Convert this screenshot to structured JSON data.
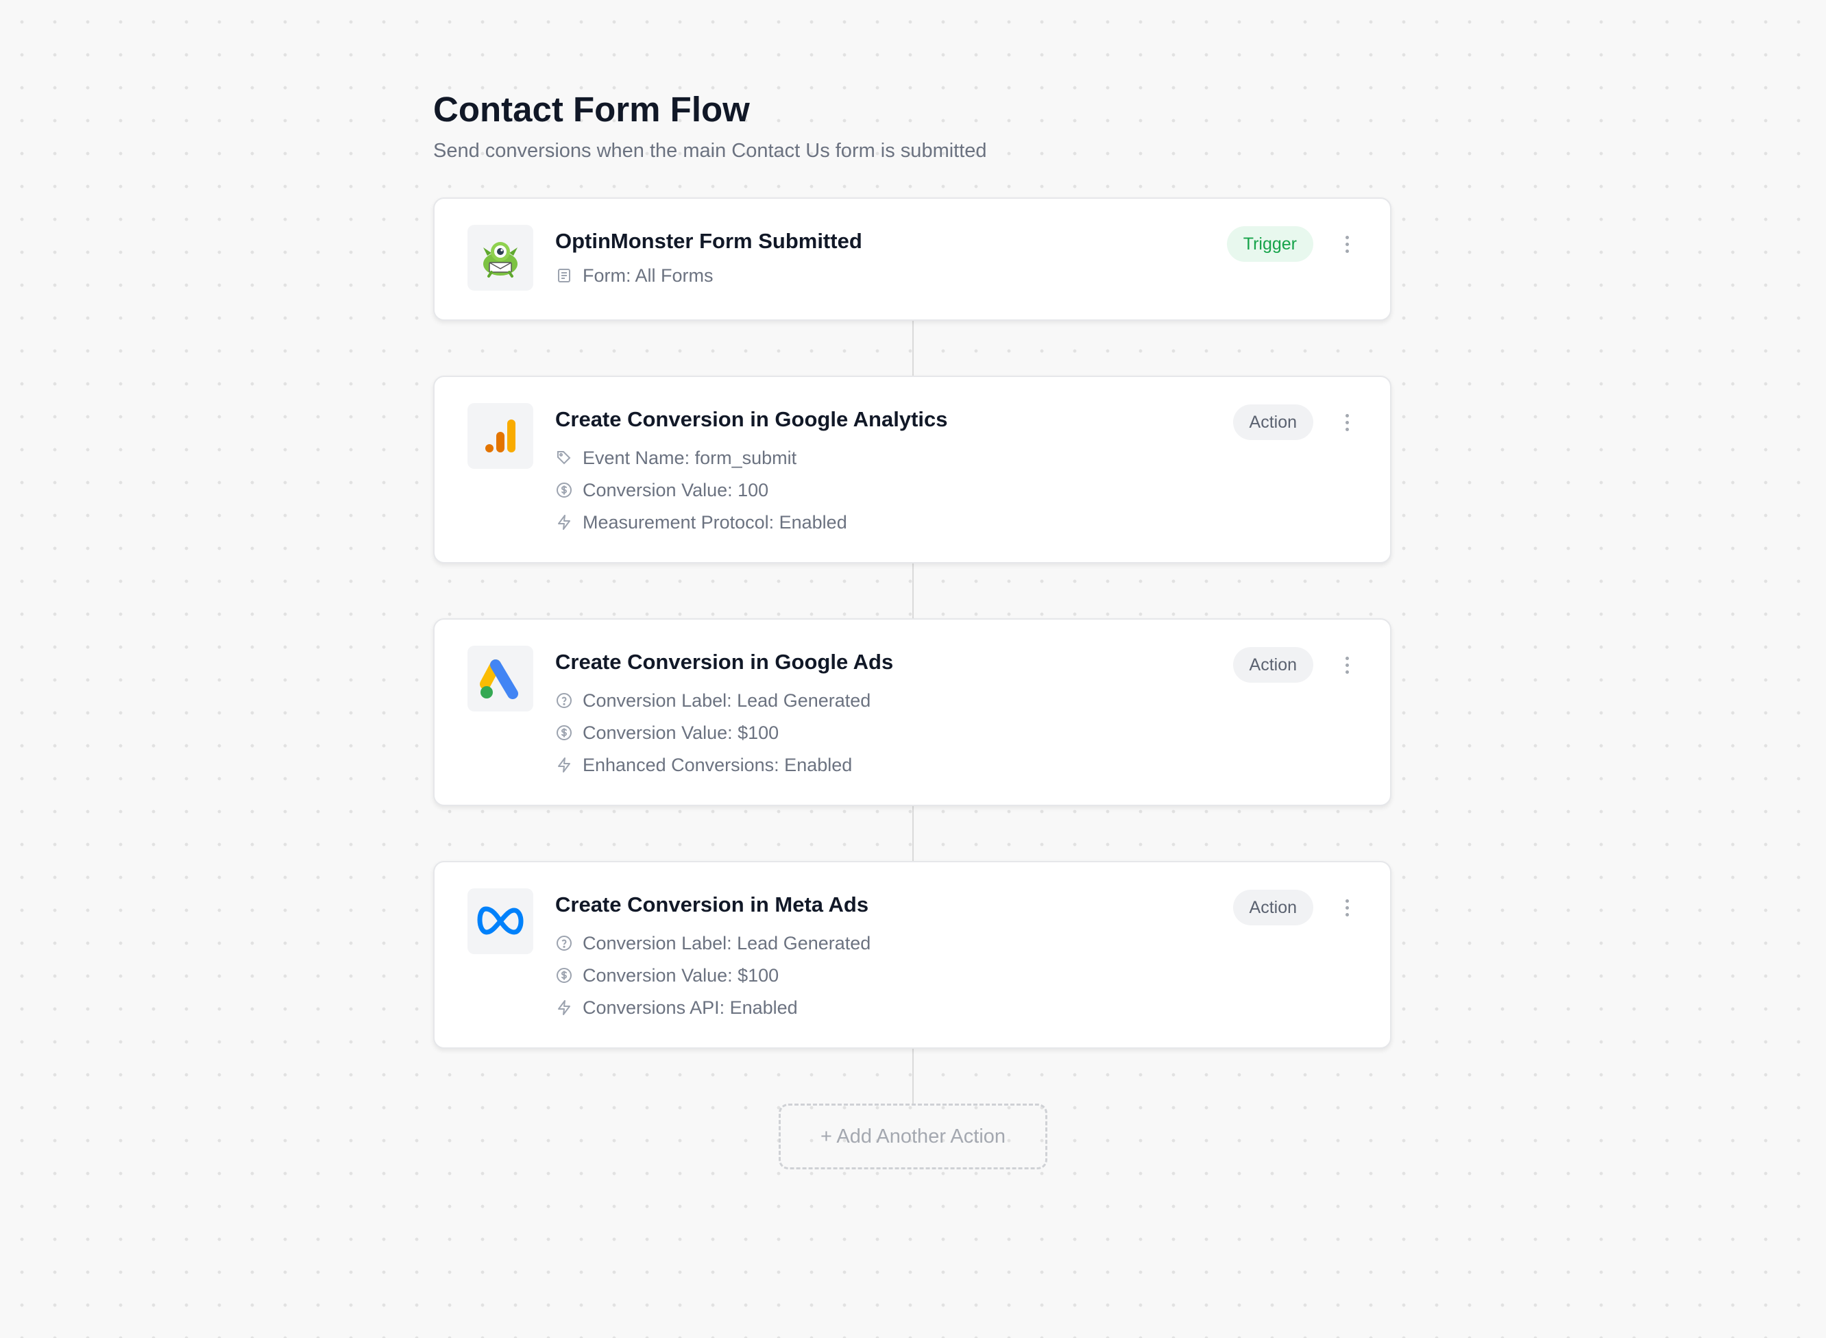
{
  "flow": {
    "title": "Contact Form Flow",
    "subtitle": "Send conversions when the main Contact Us form is submitted"
  },
  "trigger": {
    "title": "OptinMonster Form Submitted",
    "badge": "Trigger",
    "logo": "optinmonster-logo",
    "details": [
      {
        "icon": "form-icon",
        "text": "Form: All Forms"
      }
    ]
  },
  "actions": [
    {
      "title": "Create Conversion in Google Analytics",
      "badge": "Action",
      "logo": "google-analytics-logo",
      "details": [
        {
          "icon": "tag-icon",
          "text": "Event Name: form_submit"
        },
        {
          "icon": "dollar-icon",
          "text": "Conversion Value: 100"
        },
        {
          "icon": "lightning-icon",
          "text": "Measurement Protocol: Enabled"
        }
      ]
    },
    {
      "title": "Create Conversion in Google Ads",
      "badge": "Action",
      "logo": "google-ads-logo",
      "details": [
        {
          "icon": "help-circle-icon",
          "text": "Conversion Label: Lead Generated"
        },
        {
          "icon": "dollar-icon",
          "text": "Conversion Value: $100"
        },
        {
          "icon": "lightning-icon",
          "text": "Enhanced Conversions: Enabled"
        }
      ]
    },
    {
      "title": "Create Conversion in Meta Ads",
      "badge": "Action",
      "logo": "meta-logo",
      "details": [
        {
          "icon": "help-circle-icon",
          "text": "Conversion Label: Lead Generated"
        },
        {
          "icon": "dollar-icon",
          "text": "Conversion Value: $100"
        },
        {
          "icon": "lightning-icon",
          "text": "Conversions API: Enabled"
        }
      ]
    }
  ],
  "add_action": {
    "label": "+ Add Another Action"
  },
  "colors": {
    "trigger_badge_bg": "#e8f8ee",
    "trigger_badge_text": "#16a34a",
    "action_badge_bg": "#f1f2f4",
    "ga_orange": "#f9ab00",
    "ga_dark_orange": "#e37400",
    "ads_blue": "#4285f4",
    "ads_yellow": "#fbbc04",
    "ads_green": "#34a853",
    "meta_blue": "#0081fb"
  }
}
